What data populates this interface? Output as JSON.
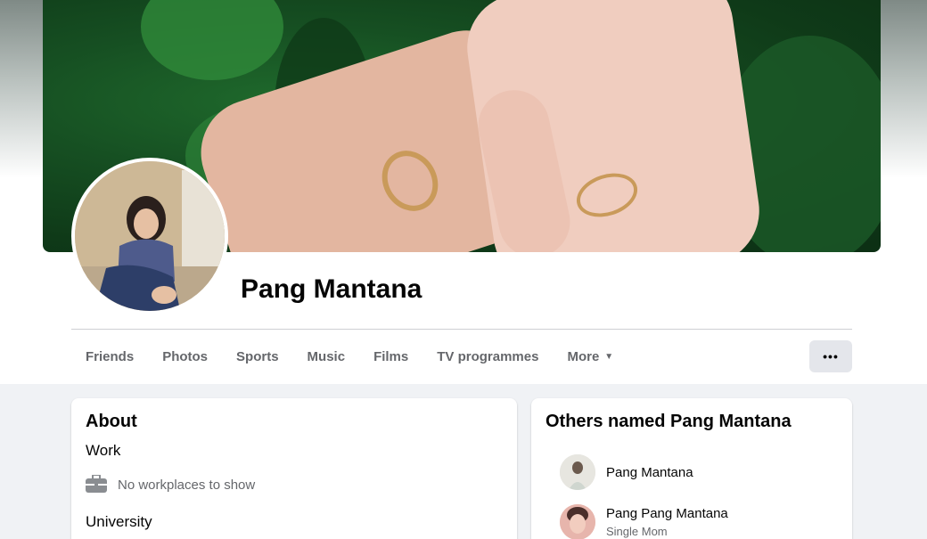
{
  "profile": {
    "name": "Pang Mantana"
  },
  "tabs": [
    {
      "label": "Friends"
    },
    {
      "label": "Photos"
    },
    {
      "label": "Sports"
    },
    {
      "label": "Music"
    },
    {
      "label": "Films"
    },
    {
      "label": "TV programmes"
    },
    {
      "label": "More"
    }
  ],
  "more_options_label": "•••",
  "about": {
    "title": "About",
    "work_label": "Work",
    "work_empty": "No workplaces to show",
    "university_label": "University"
  },
  "others": {
    "title": "Others named Pang Mantana",
    "people": [
      {
        "name": "Pang Mantana",
        "subtitle": ""
      },
      {
        "name": "Pang Pang Mantana",
        "subtitle": "Single Mom"
      }
    ]
  },
  "icons": {
    "work": "briefcase-icon",
    "more_caret": "caret-down-icon",
    "more_options": "ellipsis-icon"
  },
  "colors": {
    "page_bg": "#f0f2f5",
    "card_bg": "#ffffff",
    "secondary_text": "#65676b",
    "button_bg": "#e4e6eb"
  }
}
